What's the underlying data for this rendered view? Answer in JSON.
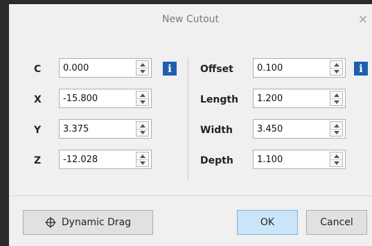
{
  "dialog": {
    "title": "New Cutout",
    "close_glyph": "×"
  },
  "left_fields": [
    {
      "label": "C",
      "value": "0.000"
    },
    {
      "label": "X",
      "value": "-15.800"
    },
    {
      "label": "Y",
      "value": "3.375"
    },
    {
      "label": "Z",
      "value": "-12.028"
    }
  ],
  "right_fields": [
    {
      "label": "Offset",
      "value": "0.100"
    },
    {
      "label": "Length",
      "value": "1.200"
    },
    {
      "label": "Width",
      "value": "3.450"
    },
    {
      "label": "Depth",
      "value": "1.100"
    }
  ],
  "info_glyph": "i",
  "buttons": {
    "dynamic_drag": "Dynamic Drag",
    "ok": "OK",
    "cancel": "Cancel"
  },
  "icons": {
    "info": "info-icon",
    "drag": "crosshair-icon",
    "close": "close-icon"
  },
  "colors": {
    "info_bg": "#1d5fae",
    "ok_bg": "#cce4f7"
  }
}
